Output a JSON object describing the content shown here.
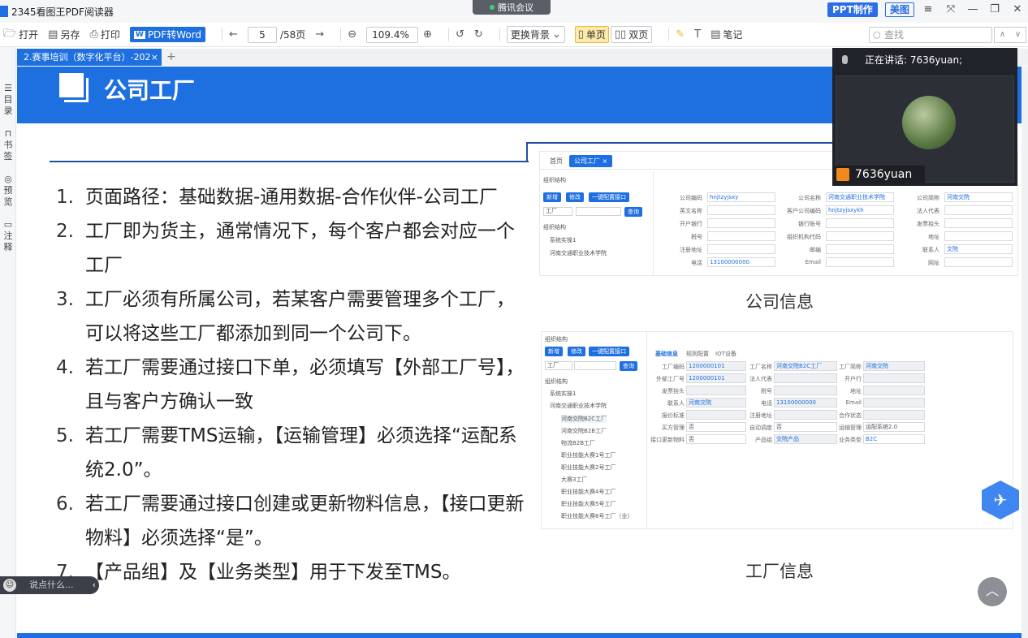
{
  "app": {
    "title": "2345看图王PDF阅读器"
  },
  "meeting": {
    "label": "腾讯会议"
  },
  "header_buttons": {
    "ppt": "PPT制作",
    "meitu": "美图"
  },
  "window_controls": {
    "menu": "≡",
    "shrink": "⤧",
    "minimize": "—",
    "restore": "❐",
    "close": "✕"
  },
  "toolbar": {
    "open": "打开",
    "save_as": "另存",
    "print": "打印",
    "pdf_to_word": "PDF转Word",
    "current_page": "5",
    "total_pages": "/58页",
    "zoom": "109.4%",
    "bg": "更换背景",
    "single": "单页",
    "double": "双页",
    "notes": "笔记",
    "search_placeholder": "查找"
  },
  "tab": {
    "label": "2.赛事培训（数字化平台）-202"
  },
  "left_strip": [
    "目录",
    "书签",
    "预览",
    "注释"
  ],
  "slide": {
    "title": "公司工厂",
    "points": [
      {
        "num": "1.",
        "text": "页面路径：基础数据-通用数据-合作伙伴-公司工厂"
      },
      {
        "num": "2.",
        "text": "工厂即为货主，通常情况下，每个客户都会对应一个工厂"
      },
      {
        "num": "3.",
        "text": "工厂必须有所属公司，若某客户需要管理多个工厂，可以将这些工厂都添加到同一个公司下。"
      },
      {
        "num": "4.",
        "text": "若工厂需要通过接口下单，必须填写【外部工厂号】，且与客户方确认一致"
      },
      {
        "num": "5.",
        "text": "若工厂需要TMS运输，【运输管理】必须选择“运配系统2.0”。"
      },
      {
        "num": "6.",
        "text": "若工厂需要通过接口创建或更新物料信息，【接口更新物料】必须选择“是”。"
      },
      {
        "num": "7.",
        "text": "【产品组】及【业务类型】用于下发至TMS。"
      }
    ],
    "caption_company": "公司信息",
    "caption_factory": "工厂信息"
  },
  "shot1": {
    "tabs": [
      "首页",
      "公司工厂 ×"
    ],
    "tree_title": "组织结构",
    "buttons": [
      "新增",
      "修改",
      "一键配置接口"
    ],
    "select": "工厂",
    "query": "查询",
    "tree": [
      "组织结构",
      "系统实操1",
      "河南交通职业技术学院"
    ],
    "fields": [
      {
        "label": "公司编码",
        "value": "hnjtzyjsxy"
      },
      {
        "label": "公司名称",
        "value": "河南交通职业技术学院"
      },
      {
        "label": "公司简称",
        "value": "河南交院"
      },
      {
        "label": "英文名称",
        "value": ""
      },
      {
        "label": "客户公司编码",
        "value": "hnjtzyjsxykh"
      },
      {
        "label": "法人代表",
        "value": ""
      },
      {
        "label": "开户银行",
        "value": ""
      },
      {
        "label": "银行账号",
        "value": ""
      },
      {
        "label": "发票抬头",
        "value": ""
      },
      {
        "label": "税号",
        "value": ""
      },
      {
        "label": "组织机构代码",
        "value": ""
      },
      {
        "label": "地址",
        "value": ""
      },
      {
        "label": "注册地址",
        "value": ""
      },
      {
        "label": "邮编",
        "value": ""
      },
      {
        "label": "联系人",
        "value": "文院"
      },
      {
        "label": "电话",
        "value": "13100000000"
      },
      {
        "label": "Email",
        "value": ""
      },
      {
        "label": "网址",
        "value": ""
      }
    ]
  },
  "shot2": {
    "tree_title": "组织结构",
    "buttons": [
      "新增",
      "修改",
      "一键配置接口"
    ],
    "select": "工厂",
    "query": "查询",
    "tabs": [
      "基础信息",
      "规则配置",
      "IOT设备"
    ],
    "tree": [
      "组织结构",
      "系统实操1",
      "河南交通职业技术学院",
      "河南交院B2C工厂",
      "河南交院B2B工厂",
      "物流B2B工厂",
      "职业技能大赛1号工厂",
      "职业技能大赛2号工厂",
      "大赛3工厂",
      "职业技能大赛4号工厂",
      "职业技能大赛5号工厂",
      "职业技能大赛6号工厂（业）"
    ],
    "fields": [
      {
        "label": "工厂编码",
        "value": "1200000101"
      },
      {
        "label": "工厂名称",
        "value": "河南交院B2C工厂"
      },
      {
        "label": "工厂简称",
        "value": "河南交院"
      },
      {
        "label": "外部工厂号",
        "value": "1200000101"
      },
      {
        "label": "法人代表",
        "value": ""
      },
      {
        "label": "开户行",
        "value": ""
      },
      {
        "label": "发票抬头",
        "value": ""
      },
      {
        "label": "税号",
        "value": ""
      },
      {
        "label": "地址",
        "value": ""
      },
      {
        "label": "联系人",
        "value": "河南交院"
      },
      {
        "label": "电话",
        "value": "13100000000"
      },
      {
        "label": "Email",
        "value": ""
      },
      {
        "label": "报价标准",
        "value": ""
      },
      {
        "label": "注册地址",
        "value": ""
      },
      {
        "label": "合作状态",
        "value": ""
      },
      {
        "label": "买方管理",
        "value": "否"
      },
      {
        "label": "自动调度",
        "value": "否"
      },
      {
        "label": "运输管理",
        "value": "运配系统2.0"
      },
      {
        "label": "接口更新物料",
        "value": "否"
      },
      {
        "label": "产品组",
        "value": "交院产品"
      },
      {
        "label": "业务类型",
        "value": "B2C"
      }
    ]
  },
  "video": {
    "speaking": "正在讲话: 7636yuan;",
    "name": "7636yuan"
  },
  "chat": {
    "placeholder": "说点什么..."
  }
}
